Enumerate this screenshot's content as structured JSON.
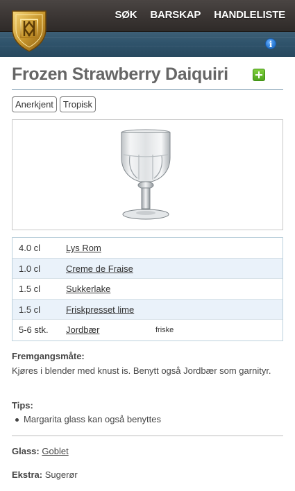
{
  "header": {
    "logo_icon": "shield-logo-icon",
    "nav": [
      {
        "label": "SØK"
      },
      {
        "label": "BARSKAP"
      },
      {
        "label": "HANDLELISTE"
      }
    ],
    "info_icon": "info-icon",
    "colors": {
      "top_bar": "#3a3533",
      "bottom_bar": "#2f536b",
      "accent": "#2e7fd8"
    }
  },
  "drink": {
    "title": "Frozen Strawberry Daiquiri",
    "add_icon": "plus-icon",
    "tags": [
      "Anerkjent",
      "Tropisk"
    ],
    "image_icon": "goblet-glass-image"
  },
  "ingredients": [
    {
      "amount": "4.0 cl",
      "name": "Lys Rom",
      "note": ""
    },
    {
      "amount": "1.0 cl",
      "name": "Creme de Fraise",
      "note": ""
    },
    {
      "amount": "1.5 cl",
      "name": "Sukkerlake",
      "note": ""
    },
    {
      "amount": "1.5 cl",
      "name": "Friskpresset lime",
      "note": ""
    },
    {
      "amount": "5-6 stk.",
      "name": "Jordbær",
      "note": "friske"
    }
  ],
  "method": {
    "label": "Fremgangsmåte:",
    "text": "Kjøres i blender med knust is. Benytt også Jordbær som garnityr."
  },
  "tips": {
    "label": "Tips:",
    "items": [
      "Margarita glass kan også benyttes"
    ]
  },
  "glass": {
    "label": "Glass:",
    "value": "Goblet"
  },
  "extra": {
    "label": "Ekstra:",
    "value": "Sugerør"
  }
}
